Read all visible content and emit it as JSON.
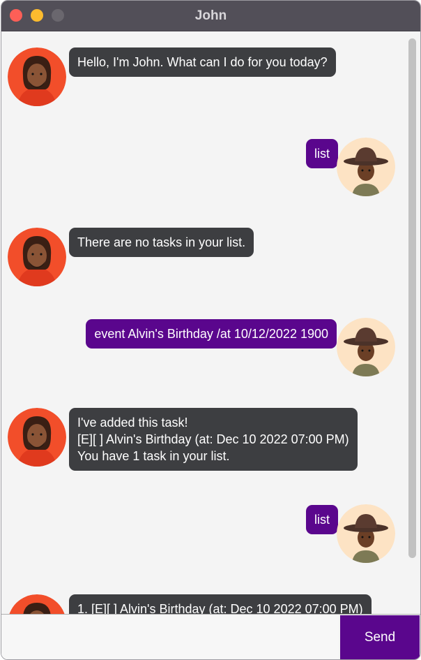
{
  "window": {
    "title": "John"
  },
  "messages": [
    {
      "sender": "bot",
      "text": "Hello, I'm John. What can I do for you today?"
    },
    {
      "sender": "user",
      "text": "list"
    },
    {
      "sender": "bot",
      "text": "There are no tasks in your list."
    },
    {
      "sender": "user",
      "text": "event Alvin's Birthday /at 10/12/2022 1900"
    },
    {
      "sender": "bot",
      "text": "I've added this task!\n[E][ ] Alvin's Birthday (at: Dec 10 2022 07:00 PM)\nYou have 1 task in your list."
    },
    {
      "sender": "user",
      "text": "list"
    },
    {
      "sender": "bot",
      "text": "1. [E][ ] Alvin's Birthday (at: Dec 10 2022 07:00 PM)"
    }
  ],
  "input": {
    "value": "",
    "placeholder": ""
  },
  "send_button": {
    "label": "Send"
  },
  "colors": {
    "titlebar": "#524f58",
    "bot_bubble": "#3d3e41",
    "user_bubble": "#5a068d",
    "bot_avatar_bg": "#f24e2a",
    "user_avatar_bg": "#fde3c4"
  }
}
